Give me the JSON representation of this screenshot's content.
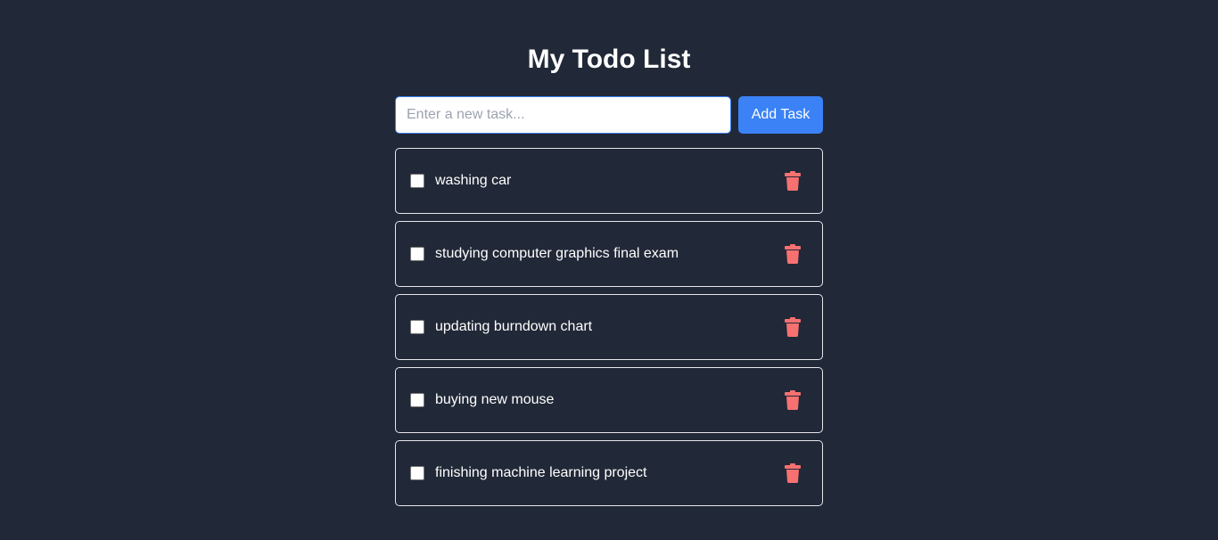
{
  "header": {
    "title": "My Todo List"
  },
  "new_task": {
    "placeholder": "Enter a new task...",
    "value": "",
    "add_button_label": "Add Task"
  },
  "todos": [
    {
      "text": "washing car",
      "completed": false,
      "delete_icon": "trash-icon"
    },
    {
      "text": "studying computer graphics final exam",
      "completed": false,
      "delete_icon": "trash-icon"
    },
    {
      "text": "updating burndown chart",
      "completed": false,
      "delete_icon": "trash-icon"
    },
    {
      "text": "buying new mouse",
      "completed": false,
      "delete_icon": "trash-icon"
    },
    {
      "text": "finishing machine learning project",
      "completed": false,
      "delete_icon": "trash-icon"
    }
  ],
  "colors": {
    "background": "#212837",
    "accent": "#3b82f6",
    "delete": "#f87171",
    "border": "#e5e7eb"
  }
}
